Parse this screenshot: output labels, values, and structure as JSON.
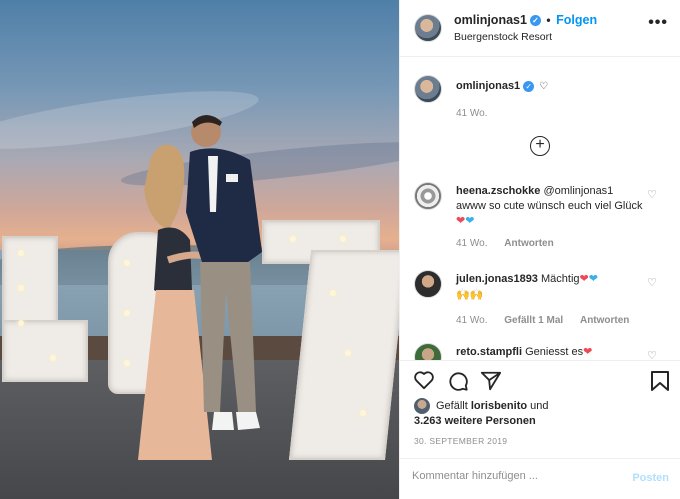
{
  "post": {
    "author": "omlinjonas1",
    "follow_label": "Folgen",
    "separator": "•",
    "location": "Buergenstock Resort",
    "caption_age": "41 Wo."
  },
  "comments": [
    {
      "user": "heena.zschokke",
      "text": "@omlinjonas1 awww so cute wünsch euch viel Glück",
      "age": "41 Wo.",
      "reply": "Antworten"
    },
    {
      "user": "julen.jonas1893",
      "text": "Mächtig",
      "age": "41 Wo.",
      "likes": "Gefällt 1 Mal",
      "reply": "Antworten"
    },
    {
      "user": "reto.stampfli",
      "text": "Geniesst es"
    }
  ],
  "likes": {
    "prefix": "Gefällt",
    "user": "lorisbenito",
    "connector": "und",
    "count_text": "3.263 weitere Personen"
  },
  "date": "30. SEPTEMBER 2019",
  "composer": {
    "placeholder": "Kommentar hinzufügen ...",
    "post_label": "Posten"
  },
  "icons": {
    "verified": "verified-badge-icon",
    "more": "more-options-icon",
    "load_more": "plus-circle-icon",
    "like": "heart-icon",
    "comment": "comment-icon",
    "share": "paper-plane-icon",
    "save": "bookmark-icon"
  },
  "colors": {
    "accent": "#0095f6",
    "verified": "#3897f0",
    "heart": "#ed4956",
    "muted": "#8e8e8e"
  }
}
